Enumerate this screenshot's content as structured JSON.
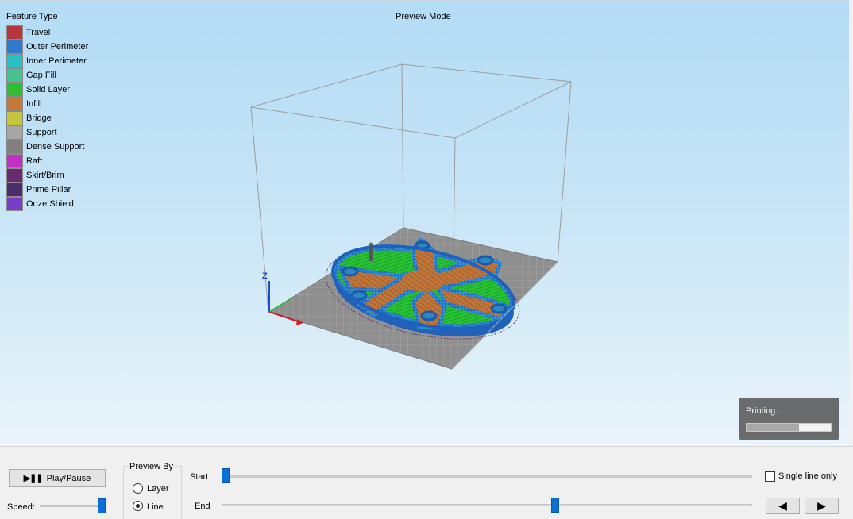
{
  "viewport": {
    "legend_title": "Feature Type",
    "mode_title": "Preview Mode",
    "legend": [
      {
        "label": "Travel",
        "color": "#b5373b"
      },
      {
        "label": "Outer Perimeter",
        "color": "#2c7bcf"
      },
      {
        "label": "Inner Perimeter",
        "color": "#27c0c4"
      },
      {
        "label": "Gap Fill",
        "color": "#47c28f"
      },
      {
        "label": "Solid Layer",
        "color": "#2fbf33"
      },
      {
        "label": "Infill",
        "color": "#c3773a"
      },
      {
        "label": "Bridge",
        "color": "#c3c53a"
      },
      {
        "label": "Support",
        "color": "#a6a6a6"
      },
      {
        "label": "Dense Support",
        "color": "#808080"
      },
      {
        "label": "Raft",
        "color": "#c12fc7"
      },
      {
        "label": "Skirt/Brim",
        "color": "#6a2a6e"
      },
      {
        "label": "Prime Pillar",
        "color": "#4c2b6e"
      },
      {
        "label": "Ooze Shield",
        "color": "#7a3ec6"
      }
    ],
    "axis_label": "Z"
  },
  "status": {
    "text": "Printing...",
    "progress": 0.62
  },
  "controls": {
    "play_label": "Play/Pause",
    "speed_label": "Speed:",
    "speed_value": 1.0,
    "preview_by_label": "Preview By",
    "layer_label": "Layer",
    "line_label": "Line",
    "selected": "line",
    "start_label": "Start",
    "end_label": "End",
    "start_value": 0.0,
    "end_value": 0.63,
    "single_line_label": "Single line only",
    "single_line_checked": false,
    "prev_icon": "triangle-left-icon",
    "next_icon": "triangle-right-icon"
  }
}
